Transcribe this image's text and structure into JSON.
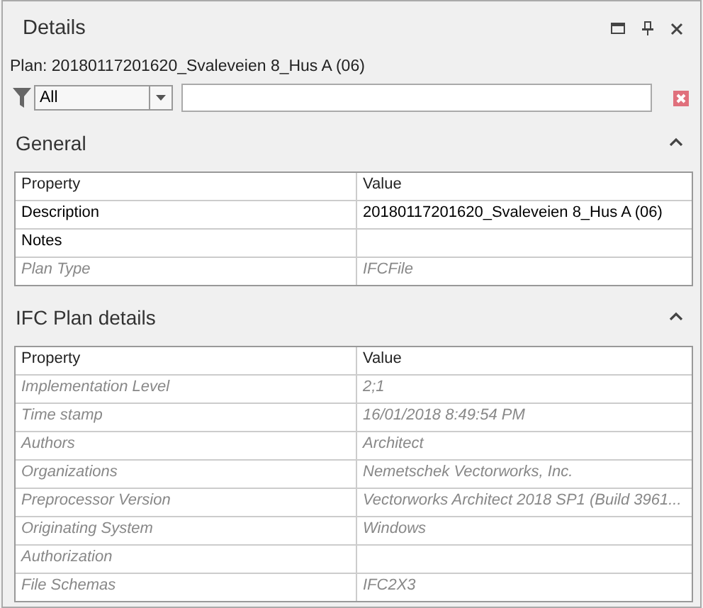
{
  "panel": {
    "title": "Details"
  },
  "plan_label": "Plan: 20180117201620_Svaleveien 8_Hus A (06)",
  "filter": {
    "value": "All"
  },
  "sections": [
    {
      "title": "General",
      "expanded": true,
      "columns": [
        "Property",
        "Value"
      ],
      "rows": [
        {
          "property": "Description",
          "value": "20180117201620_Svaleveien 8_Hus A (06)",
          "readonly": false
        },
        {
          "property": "Notes",
          "value": "",
          "readonly": false
        },
        {
          "property": "Plan Type",
          "value": "IFCFile",
          "readonly": true
        }
      ]
    },
    {
      "title": "IFC Plan details",
      "expanded": true,
      "columns": [
        "Property",
        "Value"
      ],
      "rows": [
        {
          "property": "Implementation Level",
          "value": "2;1",
          "readonly": true
        },
        {
          "property": "Time stamp",
          "value": "16/01/2018 8:49:54 PM",
          "readonly": true
        },
        {
          "property": "Authors",
          "value": "Architect",
          "readonly": true
        },
        {
          "property": "Organizations",
          "value": "Nemetschek Vectorworks, Inc.",
          "readonly": true
        },
        {
          "property": "Preprocessor Version",
          "value": "Vectorworks Architect 2018 SP1 (Build 3961...",
          "readonly": true
        },
        {
          "property": "Originating System",
          "value": "Windows",
          "readonly": true
        },
        {
          "property": "Authorization",
          "value": "",
          "readonly": true
        },
        {
          "property": "File Schemas",
          "value": "IFC2X3",
          "readonly": true
        }
      ]
    }
  ]
}
